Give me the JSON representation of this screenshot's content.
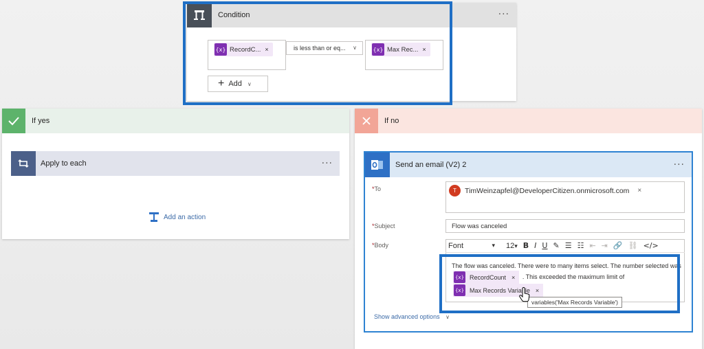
{
  "condition": {
    "title": "Condition",
    "more": "···",
    "left_operand": {
      "label": "RecordC...",
      "fx": "{x}",
      "remove": "×"
    },
    "operator": {
      "label": "is less than or eq...",
      "chevron": "∨"
    },
    "right_operand": {
      "label": "Max Rec...",
      "fx": "{x}",
      "remove": "×"
    },
    "add_button": {
      "plus": "+",
      "label": "Add",
      "chevron": "∨"
    }
  },
  "if_yes": {
    "title": "If yes",
    "apply_each": {
      "title": "Apply to each",
      "more": "···"
    },
    "add_action": "Add an action"
  },
  "if_no": {
    "title": "If no",
    "email": {
      "title": "Send an email (V2) 2",
      "more": "···",
      "to_label": "To",
      "to_avatar": "T",
      "to_value": "TimWeinzapfel@DeveloperCitizen.onmicrosoft.com",
      "to_remove": "×",
      "subject_label": "Subject",
      "subject_value": "Flow was canceled",
      "body_label": "Body",
      "required_marker": "*",
      "toolbar": {
        "font": "Font",
        "size": "12",
        "caret": "▾",
        "bold": "B",
        "italic": "I",
        "underline": "U",
        "pen": "✎",
        "bullets": "☰",
        "numbered": "☷",
        "outdent": "⇤",
        "indent": "⇥",
        "link": "🔗",
        "unlink": "⛓",
        "code": "</>"
      },
      "body_text_1": "The flow was canceled.  There were to many items select.  The number selected was",
      "body_token_1": "RecordCount",
      "body_text_2": ". This exceeded the maximum limit of",
      "body_token_2": "Max Records Variable",
      "token_fx": "{x}",
      "token_remove": "×",
      "tooltip": "variables('Max Records Variable')",
      "show_advanced": "Show advanced options",
      "show_advanced_chevron": "∨"
    }
  },
  "colors": {
    "highlight": "#1f6fc5",
    "token_fx": "#7f2fb1",
    "token_bg": "#f2e7f7",
    "yes_green": "#5db36b",
    "no_red": "#f2a597",
    "outlook_blue": "#2e70c5",
    "link_blue": "#3b6aa7"
  },
  "icons": {
    "condition": "condition-icon",
    "yes": "check-icon",
    "no": "x-icon",
    "apply_each": "loop-icon",
    "add_action": "add-action-icon",
    "email": "outlook-icon",
    "cursor": "hand-cursor-icon"
  }
}
